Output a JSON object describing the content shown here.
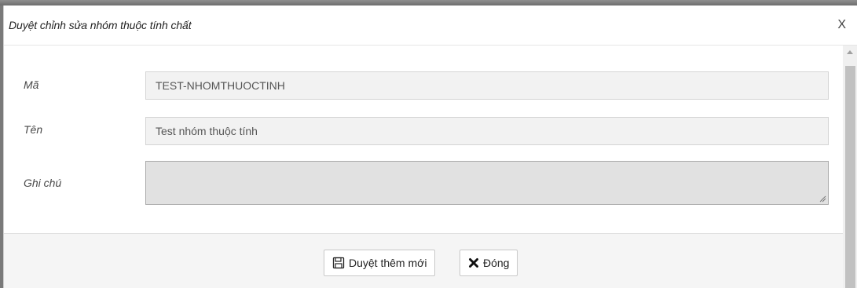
{
  "dialog": {
    "title": "Duyệt chỉnh sửa nhóm thuộc tính chất",
    "close_label": "X"
  },
  "form": {
    "code": {
      "label": "Mã",
      "value": "TEST-NHOMTHUOCTINH"
    },
    "name": {
      "label": "Tên",
      "value": "Test nhóm thuộc tính"
    },
    "note": {
      "label": "Ghi chú",
      "value": ""
    }
  },
  "footer": {
    "approve_label": "Duyệt thêm mới",
    "close_label": "Đóng"
  },
  "icons": {
    "approve": "save-icon",
    "close": "close-x-icon"
  }
}
